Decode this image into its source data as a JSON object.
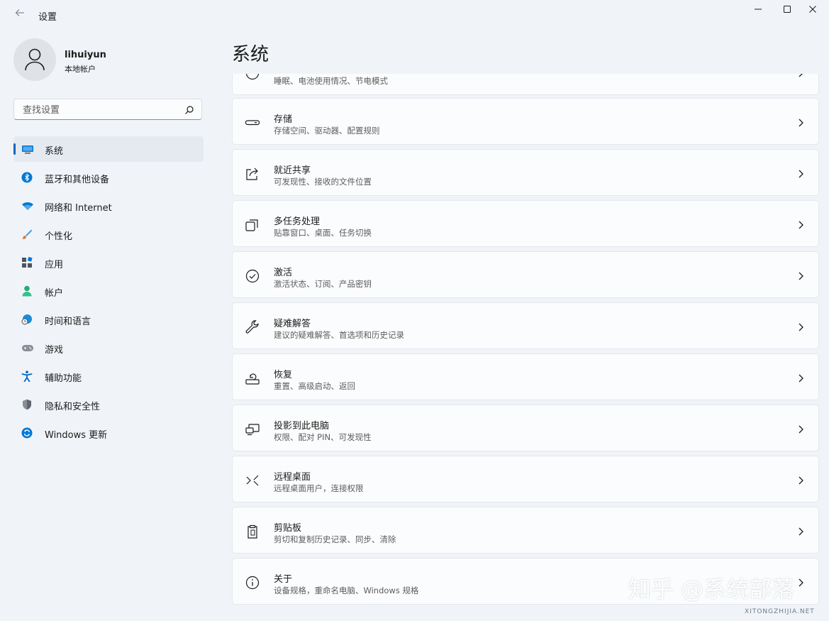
{
  "window": {
    "title": "设置",
    "back_icon": "back-arrow-icon",
    "controls": [
      "minimize-icon",
      "maximize-icon",
      "close-icon"
    ]
  },
  "profile": {
    "username": "lihuiyun",
    "account_type": "本地帐户",
    "avatar_icon": "person-icon"
  },
  "search": {
    "placeholder": "查找设置",
    "icon": "search-icon"
  },
  "nav": {
    "selected": "系统",
    "items": [
      {
        "label": "系统",
        "icon": "monitor-icon",
        "color": "#0078d4"
      },
      {
        "label": "蓝牙和其他设备",
        "icon": "bluetooth-icon",
        "color": "#0078d4"
      },
      {
        "label": "网络和 Internet",
        "icon": "wifi-icon",
        "color": "#0078d4"
      },
      {
        "label": "个性化",
        "icon": "brush-icon",
        "color": "#e07b2c"
      },
      {
        "label": "应用",
        "icon": "apps-icon",
        "color": "#4a5560"
      },
      {
        "label": "帐户",
        "icon": "account-icon",
        "color": "#2aa876"
      },
      {
        "label": "时间和语言",
        "icon": "globe-clock-icon",
        "color": "#1a8cd8"
      },
      {
        "label": "游戏",
        "icon": "gamepad-icon",
        "color": "#6b7280"
      },
      {
        "label": "辅助功能",
        "icon": "accessibility-icon",
        "color": "#0067c0"
      },
      {
        "label": "隐私和安全性",
        "icon": "shield-icon",
        "color": "#6b7280"
      },
      {
        "label": "Windows 更新",
        "icon": "update-icon",
        "color": "#0078d4"
      }
    ]
  },
  "page": {
    "title": "系统"
  },
  "settings_rows": [
    {
      "title": "",
      "subtitle": "睡眠、电池使用情况、节电模式",
      "icon": "power-icon"
    },
    {
      "title": "存储",
      "subtitle": "存储空间、驱动器、配置规则",
      "icon": "storage-icon"
    },
    {
      "title": "就近共享",
      "subtitle": "可发现性、接收的文件位置",
      "icon": "share-icon"
    },
    {
      "title": "多任务处理",
      "subtitle": "贴靠窗口、桌面、任务切换",
      "icon": "multitask-icon"
    },
    {
      "title": "激活",
      "subtitle": "激活状态、订阅、产品密钥",
      "icon": "check-circle-icon"
    },
    {
      "title": "疑难解答",
      "subtitle": "建议的疑难解答、首选项和历史记录",
      "icon": "wrench-icon"
    },
    {
      "title": "恢复",
      "subtitle": "重置、高级启动、返回",
      "icon": "recovery-icon"
    },
    {
      "title": "投影到此电脑",
      "subtitle": "权限、配对 PIN、可发现性",
      "icon": "project-icon"
    },
    {
      "title": "远程桌面",
      "subtitle": "远程桌面用户，连接权限",
      "icon": "remote-desktop-icon"
    },
    {
      "title": "剪贴板",
      "subtitle": "剪切和复制历史记录、同步、清除",
      "icon": "clipboard-icon"
    },
    {
      "title": "关于",
      "subtitle": "设备规格，重命名电脑、Windows 规格",
      "icon": "info-icon"
    }
  ],
  "watermark": {
    "text": "知乎 @系统部落",
    "site": "XITONGZHIJIA.NET"
  },
  "colors": {
    "accent": "#0067c0",
    "background": "#f0f4f9",
    "card": "#fbfcfd"
  }
}
